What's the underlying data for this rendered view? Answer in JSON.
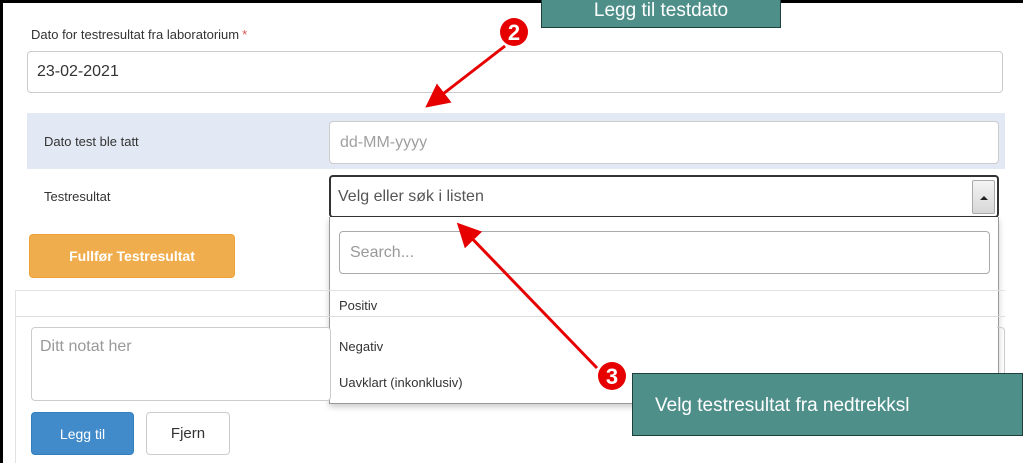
{
  "lab_result_date": {
    "label": "Dato for testresultat fra laboratorium",
    "required_marker": "*",
    "value": "23-02-2021"
  },
  "test_taken_date": {
    "label": "Dato test ble tatt",
    "placeholder": "dd-MM-yyyy"
  },
  "test_result": {
    "label": "Testresultat",
    "select_placeholder": "Velg eller søk i listen",
    "search_placeholder": "Search...",
    "options": [
      "Positiv",
      "Negativ",
      "Uavklart (inkonklusiv)"
    ]
  },
  "complete_button": "Fullfør Testresultat",
  "notes": {
    "placeholder": "Ditt notat her",
    "add_button": "Legg til",
    "remove_button": "Fjern"
  },
  "annotations": {
    "callout_top": "Legg til testdato",
    "callout_bottom": "Velg testresultat fra nedtrekksl",
    "badge_2": "2",
    "badge_3": "3",
    "arrow_color": "#e60000",
    "callout_color": "#4f8f8a"
  }
}
